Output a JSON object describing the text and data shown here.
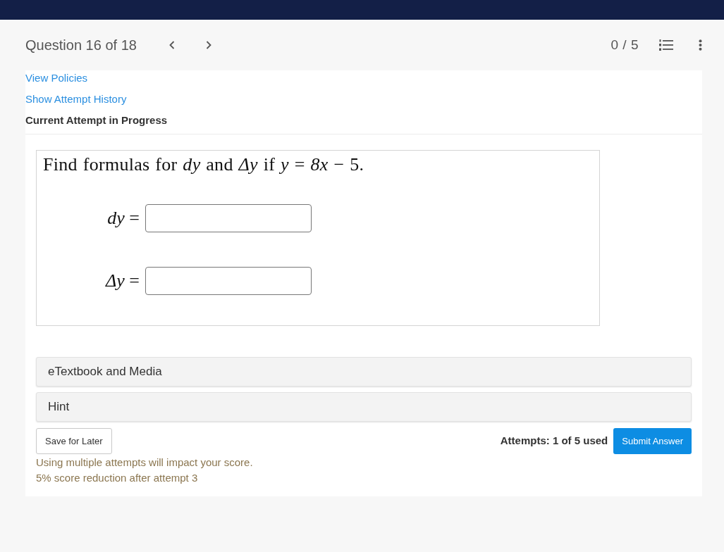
{
  "header": {
    "title": "Question 16 of 18",
    "score": "0 / 5"
  },
  "links": [
    "View Policies",
    "Show Attempt History"
  ],
  "attempt_status": "Current Attempt in Progress",
  "question": {
    "prompt": "Find formulas for *dy* and *Δy* if *y* = *8x* − 5.",
    "answers": [
      {
        "label": "*dy* ="
      },
      {
        "label": "*Δy* ="
      }
    ]
  },
  "sections": [
    {
      "label": "eTextbook and Media"
    },
    {
      "label": "Hint"
    }
  ],
  "footer": {
    "save_button": "Save for Later",
    "attempts": "Attempts: 1 of 5 used",
    "submit_button": "Submit Answer",
    "notes": [
      "Using multiple attempts will impact your score.",
      "5% score reduction after attempt 3"
    ]
  }
}
